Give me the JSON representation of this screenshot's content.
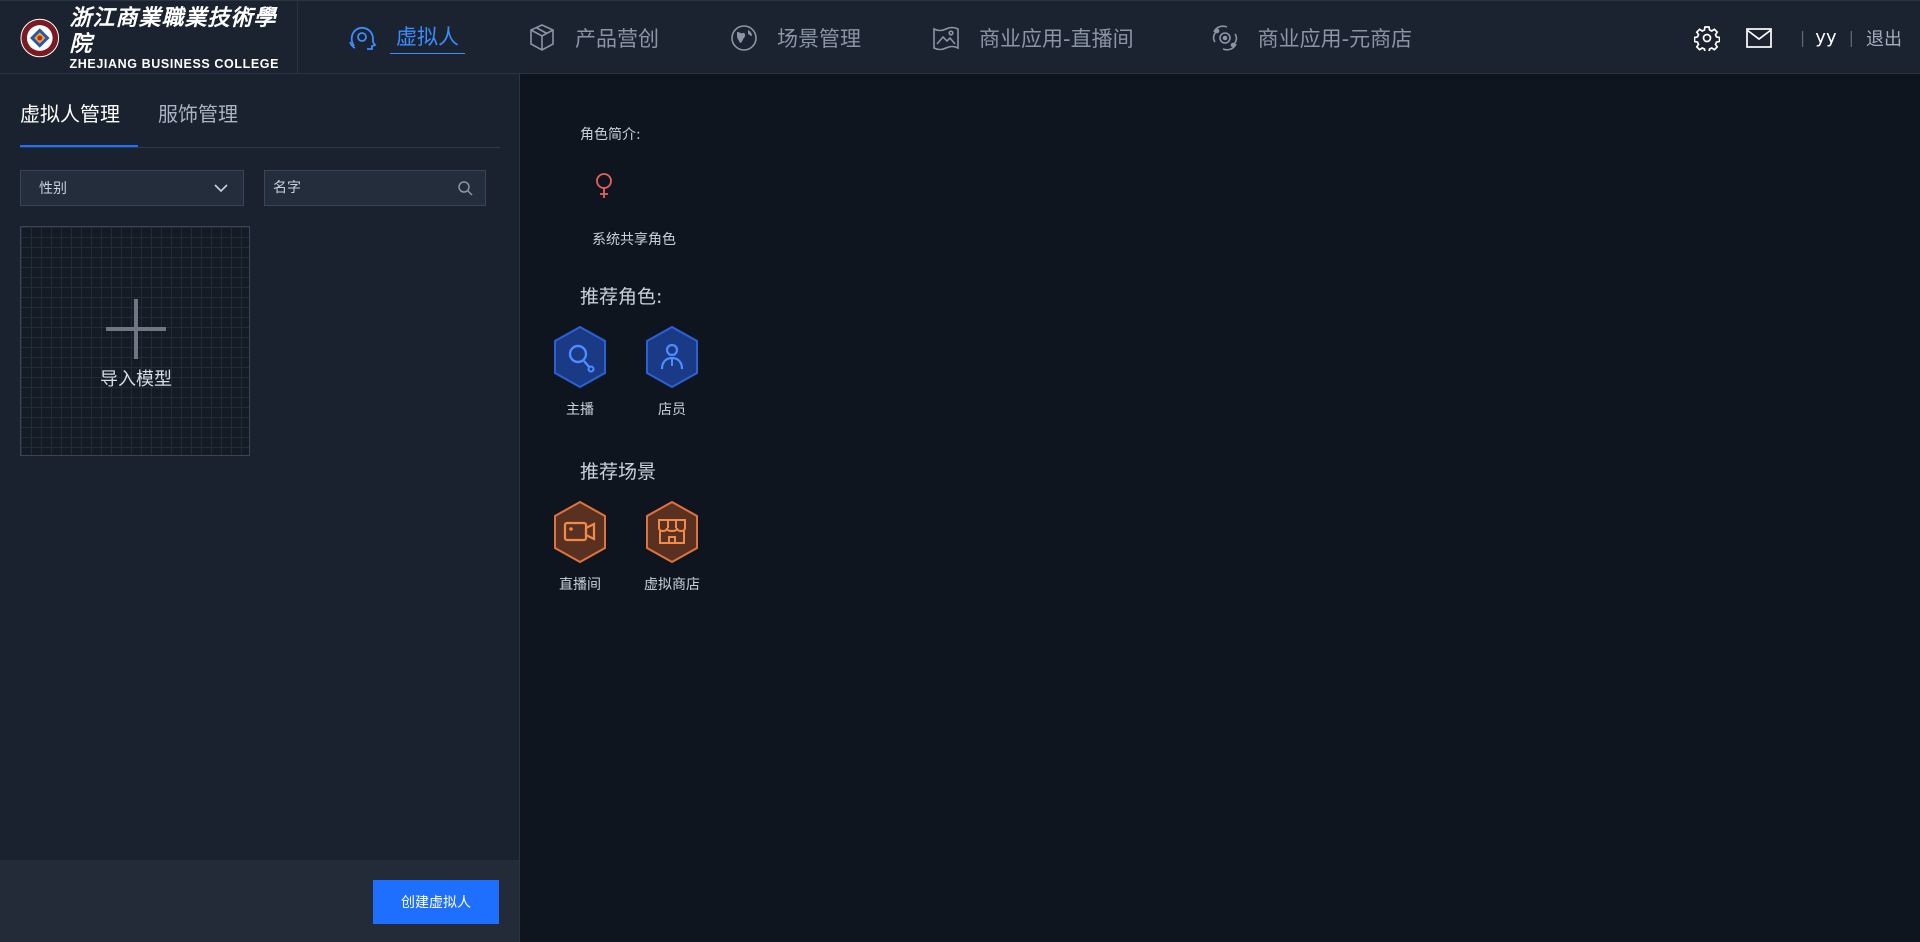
{
  "brand": {
    "name_cn": "浙江商業職業技術學院",
    "name_en": "ZHEJIANG BUSINESS COLLEGE"
  },
  "nav": {
    "items": [
      {
        "label": "虚拟人",
        "icon": "virtual-human-icon",
        "active": true
      },
      {
        "label": "产品营创",
        "icon": "product-box-icon",
        "active": false
      },
      {
        "label": "场景管理",
        "icon": "globe-icon",
        "active": false
      },
      {
        "label": "商业应用-直播间",
        "icon": "live-room-icon",
        "active": false
      },
      {
        "label": "商业应用-元商店",
        "icon": "meta-store-icon",
        "active": false
      }
    ]
  },
  "header_right": {
    "settings_icon": "gear-icon",
    "mail_icon": "mail-icon",
    "separator": "|",
    "username": "yy",
    "logout": "退出"
  },
  "sidebar": {
    "tabs": [
      {
        "label": "虚拟人管理",
        "active": true
      },
      {
        "label": "服饰管理",
        "active": false
      }
    ],
    "gender_select": {
      "value": "性别"
    },
    "name_search": {
      "placeholder": "名字"
    },
    "import_card": {
      "label": "导入模型"
    },
    "create_button": "创建虚拟人"
  },
  "main": {
    "intro_label": "角色简介:",
    "intro_icon": "female-symbol-icon",
    "intro_text": "系统共享角色",
    "recommended_roles_title": "推荐角色:",
    "recommended_roles": [
      {
        "label": "主播",
        "icon": "anchor-icon"
      },
      {
        "label": "店员",
        "icon": "clerk-icon"
      }
    ],
    "recommended_scenes_title": "推荐场景",
    "recommended_scenes": [
      {
        "label": "直播间",
        "icon": "video-camera-icon"
      },
      {
        "label": "虚拟商店",
        "icon": "storefront-icon"
      }
    ]
  },
  "colors": {
    "accent": "#1f6fff",
    "nav_active": "#3b8cff",
    "role_hex": "#2a62d6",
    "scene_hex": "#e0733d",
    "female_symbol": "#e8615a"
  }
}
